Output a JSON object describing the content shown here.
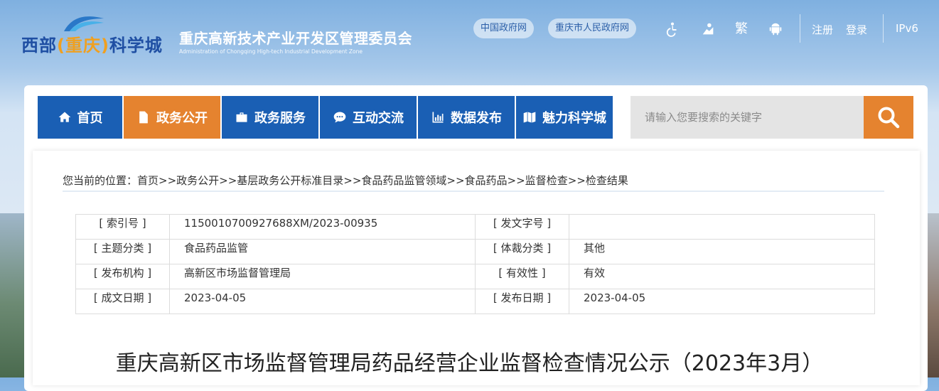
{
  "header": {
    "logo_text_part1": "西部",
    "logo_text_paren": "(重庆)",
    "logo_text_part2": "科学城",
    "org_name_cn": "重庆高新技术产业开发区管理委员会",
    "org_name_en": "Administration of Chongqing High-tech Industrial Development Zone",
    "links": [
      "中国政府网",
      "重庆市人民政府网"
    ],
    "traditional_label": "繁",
    "register": "注册",
    "login": "登录",
    "ipv6": "IPv6"
  },
  "nav": {
    "items": [
      {
        "label": "首页",
        "icon": "home-icon"
      },
      {
        "label": "政务公开",
        "icon": "document-icon",
        "active": true
      },
      {
        "label": "政务服务",
        "icon": "briefcase-icon"
      },
      {
        "label": "互动交流",
        "icon": "chat-icon"
      },
      {
        "label": "数据发布",
        "icon": "bar-chart-icon"
      },
      {
        "label": "魅力科学城",
        "icon": "map-icon"
      }
    ],
    "search_placeholder": "请输入您要搜索的关键字"
  },
  "breadcrumb": "您当前的位置：首页>>政务公开>>基层政务公开标准目录>>食品药品监管领域>>食品药品>>监督检查>>检查结果",
  "meta": {
    "rows": [
      {
        "k1": "[ 索引号 ]",
        "v1": "1150010700927688XM/2023-00935",
        "k2": "[ 发文字号 ]",
        "v2": ""
      },
      {
        "k1": "[ 主题分类 ]",
        "v1": "食品药品监管",
        "k2": "[ 体裁分类 ]",
        "v2": "其他"
      },
      {
        "k1": "[ 发布机构 ]",
        "v1": "高新区市场监督管理局",
        "k2": "[ 有效性 ]",
        "v2": "有效"
      },
      {
        "k1": "[ 成文日期 ]",
        "v1": "2023-04-05",
        "k2": "[ 发布日期 ]",
        "v2": "2023-04-05"
      }
    ]
  },
  "article": {
    "title": "重庆高新区市场监督管理局药品经营企业监督检查情况公示（2023年3月）"
  },
  "colors": {
    "nav_blue": "#1a5fb4",
    "accent_orange": "#e5832f"
  }
}
